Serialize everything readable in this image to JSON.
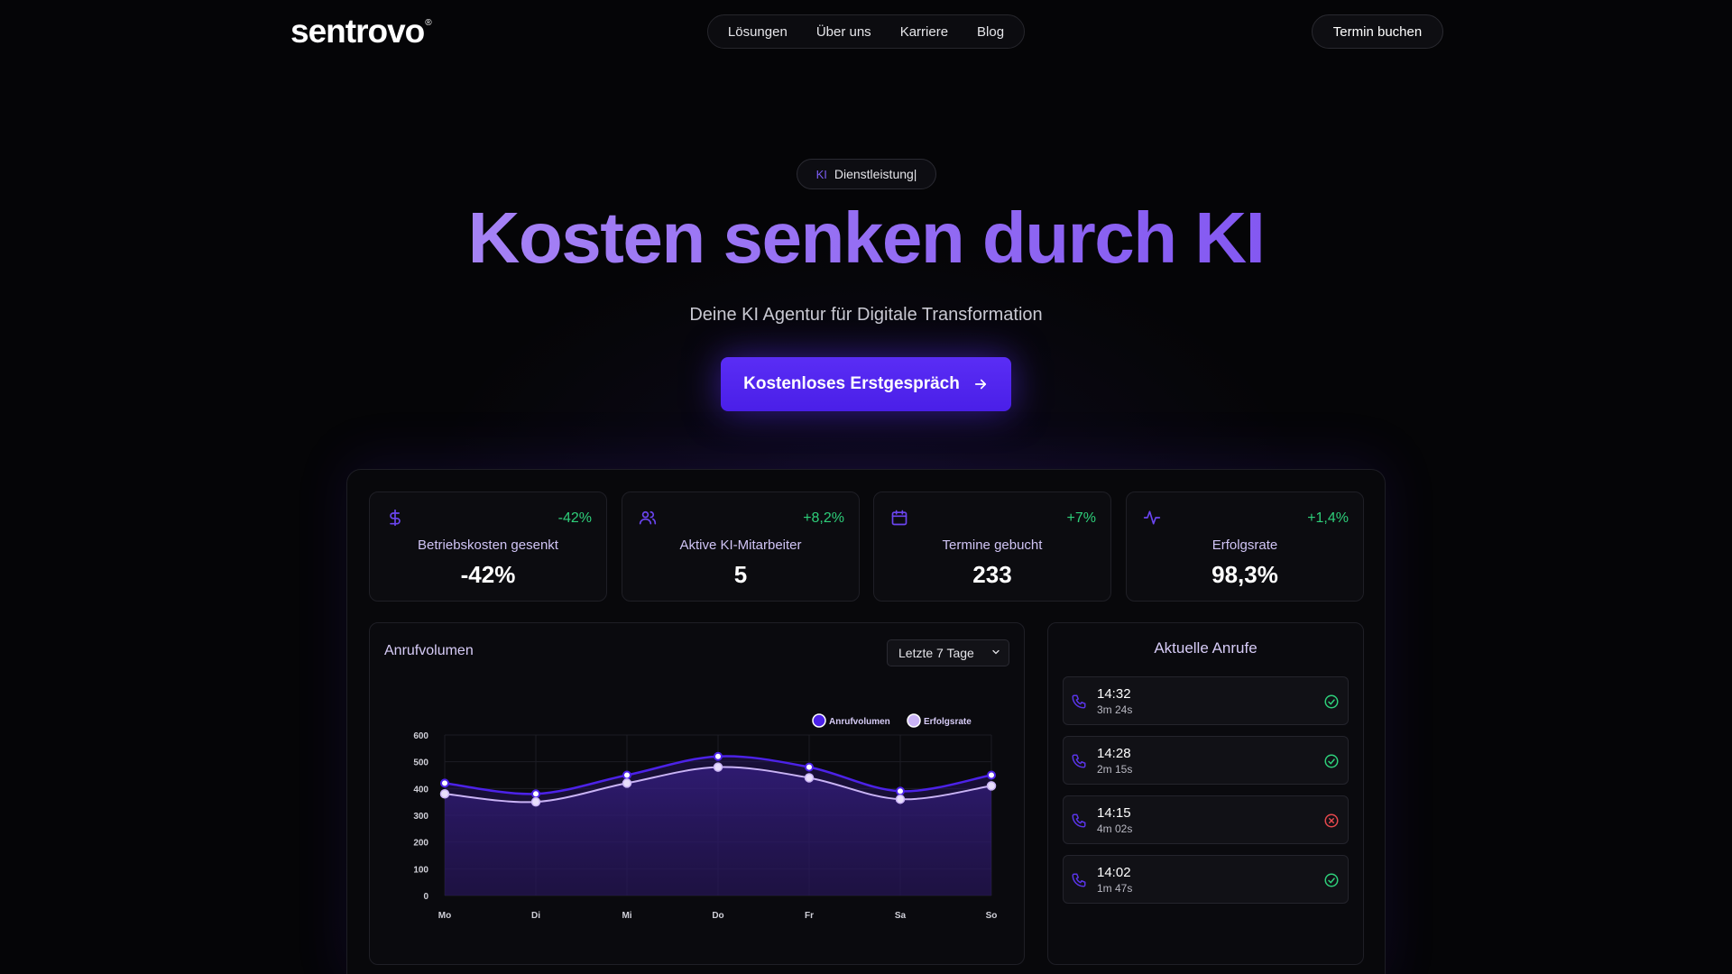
{
  "nav": {
    "logo": "sentrovo",
    "logo_mark": "®",
    "links": [
      "Lösungen",
      "Über uns",
      "Karriere",
      "Blog"
    ],
    "book_button": "Termin buchen"
  },
  "hero": {
    "badge_prefix": "KI",
    "badge_text": "Dienstleistung|",
    "title": "Kosten senken durch KI",
    "subtitle": "Deine KI Agentur für Digitale Transformation",
    "cta": "Kostenloses Erstgespräch",
    "cta_icon": "arrow-right-icon"
  },
  "stats": [
    {
      "icon": "dollar-icon",
      "delta": "-42%",
      "label": "Betriebskosten gesenkt",
      "value": "-42%"
    },
    {
      "icon": "users-icon",
      "delta": "+8,2%",
      "label": "Aktive KI-Mitarbeiter",
      "value": "5"
    },
    {
      "icon": "calendar-icon",
      "delta": "+7%",
      "label": "Termine gebucht",
      "value": "233"
    },
    {
      "icon": "activity-icon",
      "delta": "+1,4%",
      "label": "Erfolgsrate",
      "value": "98,3%"
    }
  ],
  "chart_card": {
    "title": "Anrufvolumen",
    "range_selected": "Letzte 7 Tage"
  },
  "chart_data": {
    "type": "area",
    "categories": [
      "Mo",
      "Di",
      "Mi",
      "Do",
      "Fr",
      "Sa",
      "So"
    ],
    "series": [
      {
        "name": "Anrufvolumen",
        "values": [
          420,
          380,
          450,
          520,
          480,
          390,
          450
        ]
      },
      {
        "name": "Erfolgsrate",
        "values": [
          380,
          350,
          420,
          480,
          440,
          360,
          410
        ]
      }
    ],
    "yticks": [
      0,
      100,
      200,
      300,
      400,
      500,
      600
    ],
    "ylim": [
      0,
      600
    ],
    "legend": "top-right",
    "grid": true,
    "colors": {
      "Anrufvolumen": "#4c22e8",
      "Erfolgsrate": "#c9b3f5"
    }
  },
  "calls": {
    "title": "Aktuelle Anrufe",
    "items": [
      {
        "time": "14:32",
        "duration": "3m 24s",
        "status": "success"
      },
      {
        "time": "14:28",
        "duration": "2m 15s",
        "status": "success"
      },
      {
        "time": "14:15",
        "duration": "4m 02s",
        "status": "failed"
      },
      {
        "time": "14:02",
        "duration": "1m 47s",
        "status": "success"
      }
    ]
  },
  "colors": {
    "accent": "#5a2df5",
    "positive": "#2ecf7a",
    "negative": "#e5484d",
    "icon": "#6b45f0"
  }
}
